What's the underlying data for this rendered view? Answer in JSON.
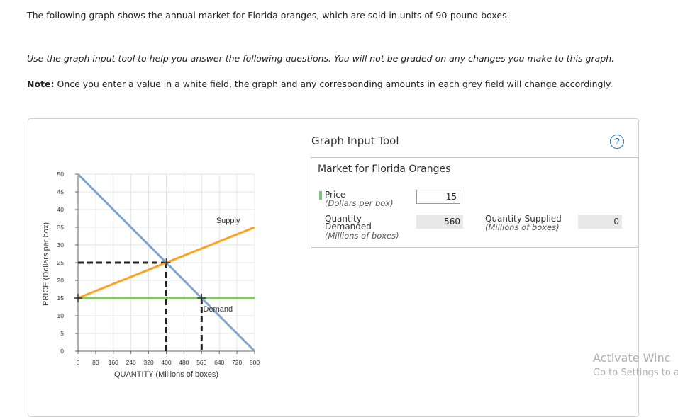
{
  "text": {
    "intro": "The following graph shows the annual market for Florida oranges, which are sold in units of 90-pound boxes.",
    "instructions": "Use the graph input tool to help you answer the following questions. You will not be graded on any changes you make to this graph.",
    "note_label": "Note:",
    "note_body": "Once you enter a value in a white field, the graph and any corresponding amounts in each grey field will change accordingly."
  },
  "tool": {
    "title": "Graph Input Tool",
    "help_glyph": "?",
    "market_title": "Market for Florida Oranges",
    "price_label": "Price",
    "price_unit": "(Dollars per box)",
    "price_value": "15",
    "qd_label_1": "Quantity",
    "qd_label_2": "Demanded",
    "qd_unit": "(Millions of boxes)",
    "qd_value": "560",
    "qs_label": "Quantity Supplied",
    "qs_unit": "(Millions of boxes)",
    "qs_value": "0"
  },
  "watermark": {
    "line1": "Activate Winc",
    "line2": "Go to Settings to a"
  },
  "colors": {
    "supply": "#ffa21f",
    "demand": "#7ea6cd",
    "price_line": "#7dcc5e",
    "dashed": "#222222"
  },
  "chart_data": {
    "type": "line",
    "xlabel": "QUANTITY (Millions of boxes)",
    "ylabel": "PRICE (Dollars per box)",
    "xlim": [
      0,
      800
    ],
    "ylim": [
      0,
      50
    ],
    "xticks": [
      0,
      80,
      160,
      240,
      320,
      400,
      480,
      560,
      640,
      720,
      800
    ],
    "yticks": [
      0,
      5,
      10,
      15,
      20,
      25,
      30,
      35,
      40,
      45,
      50
    ],
    "series": [
      {
        "name": "Supply",
        "x": [
          0,
          800
        ],
        "y": [
          15,
          35
        ],
        "label_at": [
          680,
          37
        ]
      },
      {
        "name": "Demand",
        "x": [
          0,
          800
        ],
        "y": [
          50,
          0
        ],
        "label_at": [
          560,
          12
        ]
      }
    ],
    "price_line": {
      "y": 15
    },
    "equilibrium": {
      "x": 400,
      "y": 25
    },
    "demand_point": {
      "x": 560,
      "y": 15
    },
    "supply_point": {
      "x": 0,
      "y": 15
    }
  }
}
